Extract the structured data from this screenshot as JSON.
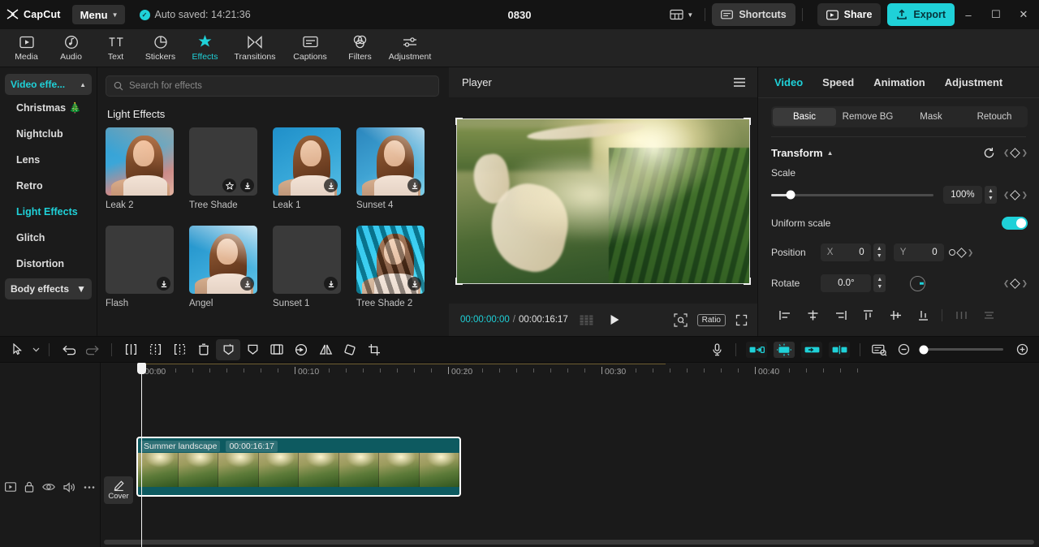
{
  "titlebar": {
    "app_name": "CapCut",
    "menu_label": "Menu",
    "autosave_text": "Auto saved: 14:21:36",
    "project_title": "0830",
    "shortcuts_label": "Shortcuts",
    "share_label": "Share",
    "export_label": "Export",
    "minimize": "–",
    "maximize": "☐",
    "close": "✕",
    "accent_color": "#1fd1d8"
  },
  "main_toolbar": {
    "items": [
      {
        "label": "Media",
        "icon": "media-icon",
        "active": false
      },
      {
        "label": "Audio",
        "icon": "audio-icon",
        "active": false
      },
      {
        "label": "Text",
        "icon": "text-icon",
        "active": false
      },
      {
        "label": "Stickers",
        "icon": "stickers-icon",
        "active": false
      },
      {
        "label": "Effects",
        "icon": "effects-icon",
        "active": true
      },
      {
        "label": "Transitions",
        "icon": "transitions-icon",
        "active": false
      },
      {
        "label": "Captions",
        "icon": "captions-icon",
        "active": false
      },
      {
        "label": "Filters",
        "icon": "filters-icon",
        "active": false
      },
      {
        "label": "Adjustment",
        "icon": "adjustment-icon",
        "active": false
      }
    ]
  },
  "category_rail": {
    "header_label": "Video effe...",
    "footer_label": "Body effects",
    "items": [
      {
        "label": "Christmas 🎄",
        "active": false
      },
      {
        "label": "Nightclub",
        "active": false
      },
      {
        "label": "Lens",
        "active": false
      },
      {
        "label": "Retro",
        "active": false
      },
      {
        "label": "Light Effects",
        "active": true
      },
      {
        "label": "Glitch",
        "active": false
      },
      {
        "label": "Distortion",
        "active": false
      }
    ]
  },
  "browser": {
    "search_placeholder": "Search for effects",
    "section_title": "Light Effects",
    "effects": [
      {
        "name": "Leak 2",
        "art": "portrait-warm",
        "favorite": false,
        "download": false
      },
      {
        "name": "Tree Shade",
        "art": "placeholder",
        "favorite": true,
        "download": true
      },
      {
        "name": "Leak 1",
        "art": "portrait-blue",
        "favorite": false,
        "download": true
      },
      {
        "name": "Sunset 4",
        "art": "portrait-rays",
        "favorite": false,
        "download": true
      },
      {
        "name": "Flash",
        "art": "placeholder",
        "favorite": false,
        "download": true
      },
      {
        "name": "Angel",
        "art": "portrait-glow",
        "favorite": false,
        "download": true
      },
      {
        "name": "Sunset 1",
        "art": "placeholder",
        "favorite": false,
        "download": true
      },
      {
        "name": "Tree Shade 2",
        "art": "portrait-stripes",
        "favorite": false,
        "download": true
      }
    ]
  },
  "player": {
    "title": "Player",
    "current_time": "00:00:00:00",
    "time_separator": "/",
    "total_time": "00:00:16:17",
    "ratio_label": "Ratio"
  },
  "inspector": {
    "tabs": [
      {
        "label": "Video",
        "active": true
      },
      {
        "label": "Speed",
        "active": false
      },
      {
        "label": "Animation",
        "active": false
      },
      {
        "label": "Adjustment",
        "active": false
      }
    ],
    "subtabs": [
      {
        "label": "Basic",
        "active": true
      },
      {
        "label": "Remove BG",
        "active": false
      },
      {
        "label": "Mask",
        "active": false
      },
      {
        "label": "Retouch",
        "active": false
      }
    ],
    "transform": {
      "section_label": "Transform",
      "scale_label": "Scale",
      "scale_value": "100%",
      "scale_percent": 12,
      "uniform_label": "Uniform scale",
      "uniform_on": true,
      "position_label": "Position",
      "pos_x_label": "X",
      "pos_x_value": "0",
      "pos_y_label": "Y",
      "pos_y_value": "0",
      "rotate_label": "Rotate",
      "rotate_value": "0.0°"
    }
  },
  "timeline": {
    "ruler_labels": [
      "00:00",
      "00:10",
      "00:20",
      "00:30",
      "00:40"
    ],
    "cover_label": "Cover",
    "playhead_time": "00:00",
    "clip": {
      "name": "Summer landscape",
      "duration": "00:00:16:17",
      "selected": true,
      "frame_count": 8
    }
  }
}
